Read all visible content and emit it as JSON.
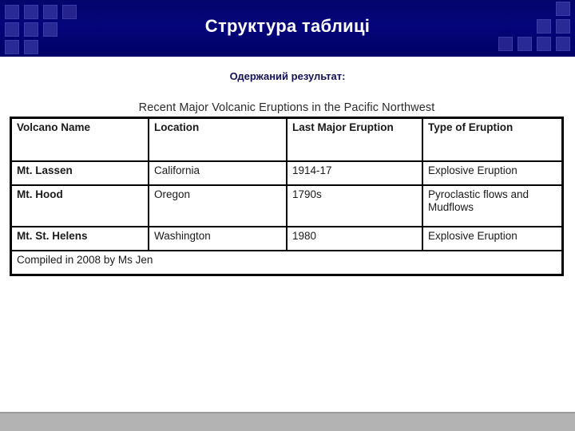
{
  "slide": {
    "title": "Структура таблиці",
    "subtitle": "Одержаний результат:"
  },
  "theme": {
    "header_bg": "#000066",
    "header_text": "#ffffff",
    "subtitle_text": "#121258",
    "deco_square": "#2a2a96",
    "bottom_bar": "#b3b3b3",
    "table_border": "#000000",
    "table_bg": "#ffffff"
  },
  "table": {
    "caption": "Recent Major Volcanic Eruptions in the Pacific Northwest",
    "columns": [
      "Volcano Name",
      "Location",
      "Last Major Eruption",
      "Type of Eruption"
    ],
    "rows": [
      {
        "name": "Mt. Lassen",
        "location": "California",
        "last_eruption": "1914-17",
        "type": "Explosive Eruption"
      },
      {
        "name": "Mt. Hood",
        "location": "Oregon",
        "last_eruption": "1790s",
        "type": "Pyroclastic flows and Mudflows"
      },
      {
        "name": "Mt. St. Helens",
        "location": "Washington",
        "last_eruption": "1980",
        "type": "Explosive Eruption"
      }
    ],
    "footer": "Compiled in 2008 by Ms Jen"
  }
}
